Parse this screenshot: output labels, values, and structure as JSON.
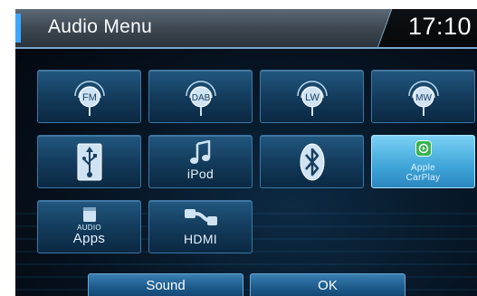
{
  "header": {
    "title": "Audio Menu",
    "clock": "17:10"
  },
  "sources": [
    {
      "key": "fm",
      "label": "FM"
    },
    {
      "key": "dab",
      "label": "DAB"
    },
    {
      "key": "lw",
      "label": "LW"
    },
    {
      "key": "mw",
      "label": "MW"
    },
    {
      "key": "usb",
      "label": ""
    },
    {
      "key": "ipod",
      "label": "iPod"
    },
    {
      "key": "bluetooth",
      "label": ""
    },
    {
      "key": "carplay",
      "label_line1": "Apple",
      "label_line2": "CarPlay",
      "selected": true
    },
    {
      "key": "apps",
      "label_small": "AUDIO",
      "label": "Apps"
    },
    {
      "key": "hdmi",
      "label": "HDMI"
    }
  ],
  "footer": {
    "sound_label": "Sound",
    "ok_label": "OK"
  },
  "colors": {
    "tile": "#1a4a70",
    "selected": "#4fb6e3",
    "accent": "#3ea6ff"
  }
}
